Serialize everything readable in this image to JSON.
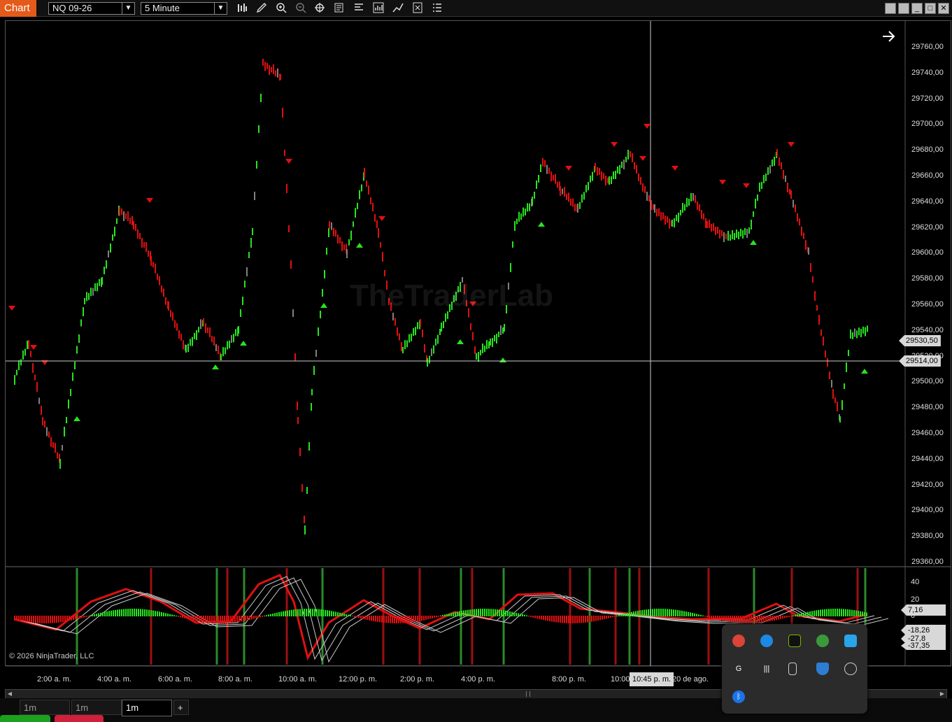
{
  "toolbar": {
    "chart_tab": "Chart",
    "instrument": "NQ 09-26",
    "interval": "5 Minute",
    "icons": [
      "bars-icon",
      "pencil-icon",
      "zoom-in-icon",
      "zoom-out-icon",
      "crosshair-icon",
      "properties-icon",
      "strategies-icon",
      "indicators-icon",
      "drawing-tools-icon",
      "data-box-icon",
      "menu-icon"
    ]
  },
  "window_buttons": [
    "minimize",
    "restore",
    "maximize",
    "close"
  ],
  "price_axis": {
    "labels": [
      "29760,00",
      "29740,00",
      "29720,00",
      "29700,00",
      "29680,00",
      "29660,00",
      "29640,00",
      "29620,00",
      "29600,00",
      "29580,00",
      "29560,00",
      "29540,00",
      "29520,00",
      "29500,00",
      "29480,00",
      "29460,00",
      "29440,00",
      "29420,00",
      "29400,00",
      "29380,00",
      "29360,00"
    ],
    "last_price": "29530,50",
    "crosshair_price": "29514,00"
  },
  "indicator_axis": {
    "labels": [
      "40",
      "20",
      "0"
    ],
    "values": [
      "7,16",
      "-18,26",
      "-27,8",
      "-37,35"
    ]
  },
  "watermark": "TheTraderLab",
  "copyright": "© 2026 NinjaTrader, LLC",
  "time_axis": {
    "labels": [
      "2:00 a. m.",
      "4:00 a. m.",
      "6:00 a. m.",
      "8:00 a. m.",
      "10:00 a. m.",
      "12:00 p. m.",
      "2:00 p. m.",
      "4:00 p. m.",
      "8:00 p. m.",
      "10:00",
      "20 de ago."
    ],
    "crosshair_time": "10:45 p. m."
  },
  "tabs": [
    {
      "label": "1m"
    },
    {
      "label": "1m"
    },
    {
      "label": "1m"
    }
  ],
  "add_tab": "+",
  "colors": {
    "up": "#27e320",
    "down": "#e01010",
    "neutral": "#808080",
    "accent": "#e35a1b"
  },
  "tray_icons": [
    "chrome-icon",
    "edge-icon",
    "nvidia-icon",
    "network-icon",
    "sync-icon",
    "g-hub-icon",
    "audio-icon",
    "usb-icon",
    "security-icon",
    "obs-icon",
    "bluetooth-icon"
  ]
}
